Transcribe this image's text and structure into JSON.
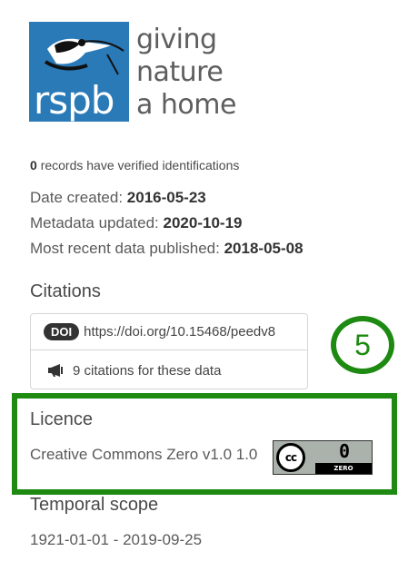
{
  "logo": {
    "brand": "rspb",
    "tagline": [
      "giving",
      "nature",
      "a home"
    ],
    "brand_color": "#2a7ab8"
  },
  "stats": {
    "verified_count": "0",
    "verified_text": "records have verified identifications",
    "date_created_label": "Date created:",
    "date_created_value": "2016-05-23",
    "metadata_updated_label": "Metadata updated:",
    "metadata_updated_value": "2020-10-19",
    "recent_published_label": "Most recent data published:",
    "recent_published_value": "2018-05-08"
  },
  "citations": {
    "title": "Citations",
    "doi_badge": "DOI",
    "doi_link": "https://doi.org/10.15468/peedv8",
    "citation_icon": "megaphone-icon",
    "citation_text": "9 citations for these data"
  },
  "annotation": {
    "number": "5",
    "color": "#1e8a12"
  },
  "licence": {
    "title": "Licence",
    "name": "Creative Commons Zero v1.0 1.0",
    "badge_cc": "cc",
    "badge_zero_big": "0",
    "badge_zero_label": "ZERO"
  },
  "temporal": {
    "title": "Temporal scope",
    "range": "1921-01-01 - 2019-09-25"
  }
}
